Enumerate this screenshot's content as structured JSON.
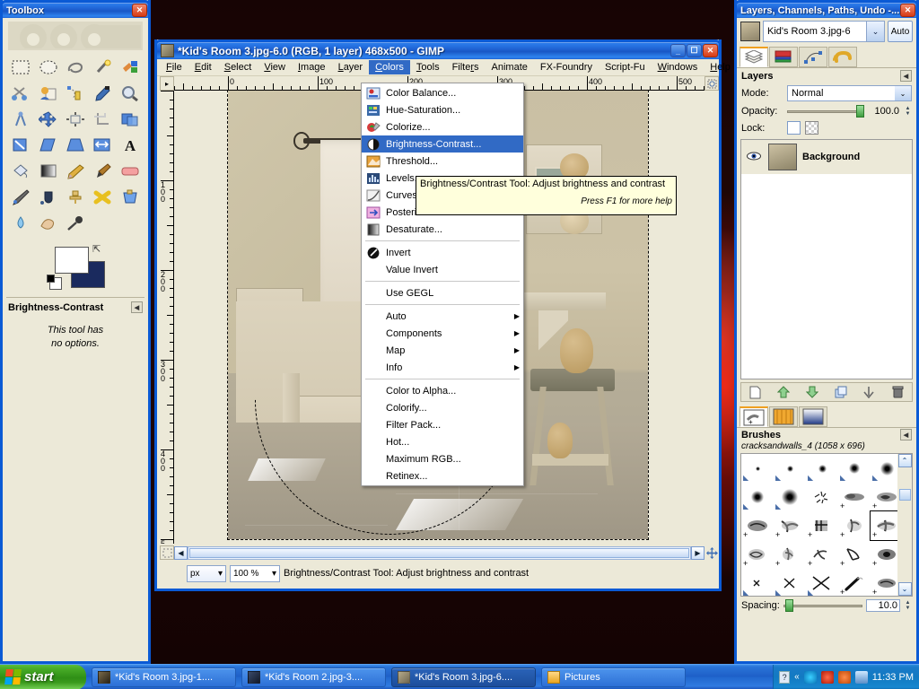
{
  "toolbox": {
    "title": "Toolbox",
    "close_label": "✕",
    "tools": [
      {
        "name": "rect-select-tool",
        "glyph": "▭"
      },
      {
        "name": "ellipse-select-tool",
        "glyph": "◯"
      },
      {
        "name": "free-select-tool",
        "glyph": "◌"
      },
      {
        "name": "fuzzy-select-tool",
        "glyph": "✦"
      },
      {
        "name": "select-by-color-tool",
        "glyph": "▣"
      },
      {
        "name": "scissors-select-tool",
        "glyph": "✄"
      },
      {
        "name": "foreground-select-tool",
        "glyph": "☻"
      },
      {
        "name": "paths-tool",
        "glyph": "✎"
      },
      {
        "name": "color-picker-tool",
        "glyph": "🖊"
      },
      {
        "name": "zoom-tool",
        "glyph": "🔍"
      },
      {
        "name": "measure-tool",
        "glyph": "⊾"
      },
      {
        "name": "move-tool",
        "glyph": "✥"
      },
      {
        "name": "align-tool",
        "glyph": "⊞"
      },
      {
        "name": "crop-tool",
        "glyph": "⌗"
      },
      {
        "name": "rotate-tool",
        "glyph": "⟳"
      },
      {
        "name": "scale-tool",
        "glyph": "⤢"
      },
      {
        "name": "shear-tool",
        "glyph": "▰"
      },
      {
        "name": "perspective-tool",
        "glyph": "▱"
      },
      {
        "name": "flip-tool",
        "glyph": "⇔"
      },
      {
        "name": "text-tool",
        "glyph": "A"
      },
      {
        "name": "bucket-fill-tool",
        "glyph": "🪣"
      },
      {
        "name": "gradient-tool",
        "glyph": "▤"
      },
      {
        "name": "pencil-tool",
        "glyph": "✏"
      },
      {
        "name": "paintbrush-tool",
        "glyph": "🖌"
      },
      {
        "name": "eraser-tool",
        "glyph": "▬"
      },
      {
        "name": "airbrush-tool",
        "glyph": "✈"
      },
      {
        "name": "ink-tool",
        "glyph": "🖋"
      },
      {
        "name": "clone-tool",
        "glyph": "⚲"
      },
      {
        "name": "heal-tool",
        "glyph": "✚"
      },
      {
        "name": "perspective-clone-tool",
        "glyph": "⚯"
      },
      {
        "name": "blur-sharpen-tool",
        "glyph": "💧"
      },
      {
        "name": "smudge-tool",
        "glyph": "☞"
      },
      {
        "name": "dodge-burn-tool",
        "glyph": "🥄"
      }
    ],
    "tool_options": {
      "title": "Brightness-Contrast",
      "note_line1": "This tool has",
      "note_line2": "no options.",
      "collapse_glyph": "◀"
    }
  },
  "gimp_window": {
    "title": "*Kid's Room 3.jpg-6.0 (RGB, 1 layer) 468x500 - GIMP",
    "minimize_label": "_",
    "maximize_label": "☐",
    "close_label": "✕",
    "menus": [
      {
        "label": "File",
        "mnemonic": "F"
      },
      {
        "label": "Edit",
        "mnemonic": "E"
      },
      {
        "label": "Select",
        "mnemonic": "S"
      },
      {
        "label": "View",
        "mnemonic": "V"
      },
      {
        "label": "Image",
        "mnemonic": "I"
      },
      {
        "label": "Layer",
        "mnemonic": "L"
      },
      {
        "label": "Colors",
        "mnemonic": "C"
      },
      {
        "label": "Tools",
        "mnemonic": "T"
      },
      {
        "label": "Filters",
        "mnemonic": "R"
      },
      {
        "label": "Animate",
        "mnemonic": ""
      },
      {
        "label": "FX-Foundry",
        "mnemonic": ""
      },
      {
        "label": "Script-Fu",
        "mnemonic": ""
      },
      {
        "label": "Windows",
        "mnemonic": "W"
      },
      {
        "label": "Help",
        "mnemonic": "H"
      }
    ],
    "active_menu": "Colors",
    "hruler_labels": [
      "0",
      "100",
      "200",
      "300",
      "400",
      "500"
    ],
    "vruler_labels": [
      "100",
      "200",
      "300",
      "400"
    ],
    "statusbar": {
      "unit": "px",
      "unit_arrow": "▾",
      "zoom": "100 %",
      "zoom_arrow": "▾",
      "message": "Brightness/Contrast Tool: Adjust brightness and contrast"
    }
  },
  "colors_menu": {
    "items": [
      {
        "label": "Color Balance...",
        "mnemonic": "B",
        "icon": "color-balance-icon",
        "type": "item"
      },
      {
        "label": "Hue-Saturation...",
        "mnemonic": "S",
        "icon": "hue-saturation-icon",
        "type": "item"
      },
      {
        "label": "Colorize...",
        "mnemonic": "z",
        "icon": "colorize-icon",
        "type": "item"
      },
      {
        "label": "Brightness-Contrast...",
        "mnemonic": "r",
        "icon": "brightness-contrast-icon",
        "type": "item",
        "selected": true
      },
      {
        "label": "Threshold...",
        "mnemonic": "T",
        "icon": "threshold-icon",
        "type": "item"
      },
      {
        "label": "Levels...",
        "mnemonic": "L",
        "icon": "levels-icon",
        "type": "item"
      },
      {
        "label": "Curves...",
        "mnemonic": "C",
        "icon": "curves-icon",
        "type": "item"
      },
      {
        "label": "Posterize...",
        "mnemonic": "P",
        "icon": "posterize-icon",
        "type": "item"
      },
      {
        "label": "Desaturate...",
        "mnemonic": "D",
        "icon": "desaturate-icon",
        "type": "item"
      },
      {
        "type": "separator"
      },
      {
        "label": "Invert",
        "mnemonic": "v",
        "icon": "invert-icon",
        "type": "item"
      },
      {
        "label": "Value Invert",
        "mnemonic": "V",
        "icon": "",
        "type": "item"
      },
      {
        "type": "separator"
      },
      {
        "label": "Use GEGL",
        "mnemonic": "G",
        "icon": "",
        "type": "item"
      },
      {
        "type": "separator"
      },
      {
        "label": "Auto",
        "mnemonic": "A",
        "icon": "",
        "type": "submenu"
      },
      {
        "label": "Components",
        "mnemonic": "o",
        "icon": "",
        "type": "submenu"
      },
      {
        "label": "Map",
        "mnemonic": "M",
        "icon": "",
        "type": "submenu"
      },
      {
        "label": "Info",
        "mnemonic": "n",
        "icon": "",
        "type": "submenu"
      },
      {
        "type": "separator"
      },
      {
        "label": "Color to Alpha...",
        "mnemonic": "A",
        "icon": "",
        "type": "item"
      },
      {
        "label": "Colorify...",
        "mnemonic": "",
        "icon": "",
        "type": "item"
      },
      {
        "label": "Filter Pack...",
        "mnemonic": "F",
        "icon": "",
        "type": "item"
      },
      {
        "label": "Hot...",
        "mnemonic": "H",
        "icon": "",
        "type": "item"
      },
      {
        "label": "Maximum RGB...",
        "mnemonic": "u",
        "icon": "",
        "type": "item"
      },
      {
        "label": "Retinex...",
        "mnemonic": "x",
        "icon": "",
        "type": "item"
      }
    ],
    "submenu_arrow": "▶"
  },
  "tooltip": {
    "text": "Brightness/Contrast Tool: Adjust brightness and contrast",
    "hint": "Press F1 for more help"
  },
  "dock": {
    "title": "Layers, Channels, Paths, Undo -...",
    "close_label": "✕",
    "image_name": "Kid's Room 3.jpg-6",
    "combo_arrow": "⌄",
    "auto_label": "Auto",
    "tabs": [
      {
        "name": "tab-layers",
        "glyph": "▤",
        "active": true
      },
      {
        "name": "tab-channels",
        "glyph": "▦",
        "active": false
      },
      {
        "name": "tab-paths",
        "glyph": "✒",
        "active": false
      },
      {
        "name": "tab-undo-history",
        "glyph": "↺",
        "active": false
      }
    ],
    "layers": {
      "section_title": "Layers",
      "collapse_glyph": "◀",
      "mode_label": "Mode:",
      "mode_value": "Normal",
      "opacity_label": "Opacity:",
      "opacity_value": "100.0",
      "lock_label": "Lock:",
      "rows": [
        {
          "name": "Background",
          "visible": true
        }
      ],
      "buttons": [
        {
          "name": "new-layer-button",
          "glyph": "🗋"
        },
        {
          "name": "raise-layer-button",
          "glyph": "⬆"
        },
        {
          "name": "lower-layer-button",
          "glyph": "⬇"
        },
        {
          "name": "duplicate-layer-button",
          "glyph": "❐"
        },
        {
          "name": "anchor-layer-button",
          "glyph": "⚓"
        },
        {
          "name": "delete-layer-button",
          "glyph": "🗑"
        }
      ]
    },
    "brush_tabs": [
      {
        "name": "tab-brushes",
        "active": true
      },
      {
        "name": "tab-patterns",
        "active": false
      },
      {
        "name": "tab-gradients",
        "active": false
      }
    ],
    "brushes": {
      "section_title": "Brushes",
      "collapse_glyph": "◀",
      "selected_brush": "cracksandwalls_4 (1058 x 696)",
      "spacing_label": "Spacing:",
      "spacing_value": "10.0",
      "scroll_up": "⌃",
      "scroll_down": "⌄"
    }
  },
  "taskbar": {
    "start_label": "start",
    "tasks": [
      {
        "label": "*Kid's Room 3.jpg-1....",
        "name": "taskbar-item-kids-room-3-1"
      },
      {
        "label": "*Kid's Room 2.jpg-3....",
        "name": "taskbar-item-kids-room-2-3"
      },
      {
        "label": "*Kid's Room 3.jpg-6....",
        "name": "taskbar-item-kids-room-3-6",
        "active": true
      },
      {
        "label": "Pictures",
        "name": "taskbar-item-pictures"
      }
    ],
    "tray": {
      "help_glyph": "?",
      "expand_glyph": "«",
      "clock": "11:33 PM"
    }
  },
  "colors": {
    "xp_blue": "#1d63d4",
    "menu_highlight": "#316ac5",
    "panel_bg": "#ece9d8",
    "tooltip_bg": "#ffffdc",
    "accent_orange": "#f0a020"
  }
}
